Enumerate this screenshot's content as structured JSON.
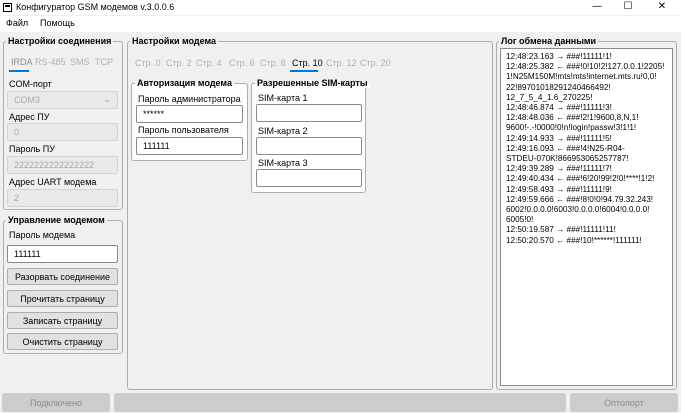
{
  "window": {
    "title": "Конфигуратор GSM модемов v.3.0.0.6",
    "minimize_glyph": "—",
    "maximize_glyph": "☐",
    "close_glyph": "✕"
  },
  "menu": [
    "Файл",
    "Помощь"
  ],
  "connection": {
    "title": "Настройки соединения",
    "tabs": [
      "IRDA",
      "RS-485",
      "SMS",
      "TCP"
    ],
    "com_label": "COM-порт",
    "com_value": "COM3",
    "pu_address_label": "Адрес ПУ",
    "pu_address_value": "0",
    "pu_password_label": "Пароль ПУ",
    "pu_password_value": "2222222222222222",
    "uart_label": "Адрес UART модема",
    "uart_value": "2"
  },
  "control": {
    "title": "Управление модемом",
    "password_label": "Пароль модема",
    "password_value": "111111",
    "buttons": [
      "Разорвать соединение",
      "Прочитать страницу",
      "Записать страницу",
      "Очистить страницу"
    ]
  },
  "modem": {
    "title": "Настройки модема",
    "pages": [
      "Стр. 0",
      "Стр. 2",
      "Стр. 4",
      "Стр. 6",
      "Стр. 8",
      "Стр. 10",
      "Стр. 12",
      "Стр. 20"
    ],
    "active_page": "Стр. 10",
    "auth": {
      "title": "Авторизация модема",
      "admin_label": "Пароль администратора",
      "admin_value": "******",
      "user_label": "Пароль пользователя",
      "user_value": "111111"
    },
    "sim": {
      "title": "Разрешенные SIM-карты",
      "sim1_label": "SIM-карта 1",
      "sim1_value": "",
      "sim2_label": "SIM-карта 2",
      "sim2_value": "",
      "sim3_label": "SIM-карта 3",
      "sim3_value": ""
    }
  },
  "log": {
    "title": "Лог обмена данными",
    "lines": [
      "12:48:23.163 → ###!11111!1!",
      "12:48:25.382 ← ###!0!10!2!127.0.0.1!2205!",
      "1!N25M150M!mts!mts!internet.mts.ru!0,0!",
      "22!89701018291240466492!",
      "12_7_5_4_1.6_270225!",
      "12:48:46.874 → ###!11111!3!",
      "12:48:48.036 ← ###!2!1!9600,8,N,1!",
      "9600!-.-!0000!0!n!login!passw!3!1!1!",
      "12:49:14.933 → ###!11111!5!",
      "12:49:16.093 ← ###!4!N25-R04-",
      "STDEU-070K!866953065257787!",
      "12:49:39.289 → ###!11111!7!",
      "12:49:40.434 ← ###!6!20!99!2!0!****!1!2!",
      "12:49:58.493 → ###!11111!9!",
      "12:49:59.666 ← ###!8!0!0!94.79.32.243!",
      "6002!0.0.0.0!6003!0.0.0.0!6004!0.0.0.0!",
      "6005!0!",
      "12:50:19.587 → ###!11111!11!",
      "12:50:20.570 ← ###!10!******!111111!"
    ]
  },
  "status": {
    "left": "Подключено",
    "right": "Оптопорт"
  }
}
